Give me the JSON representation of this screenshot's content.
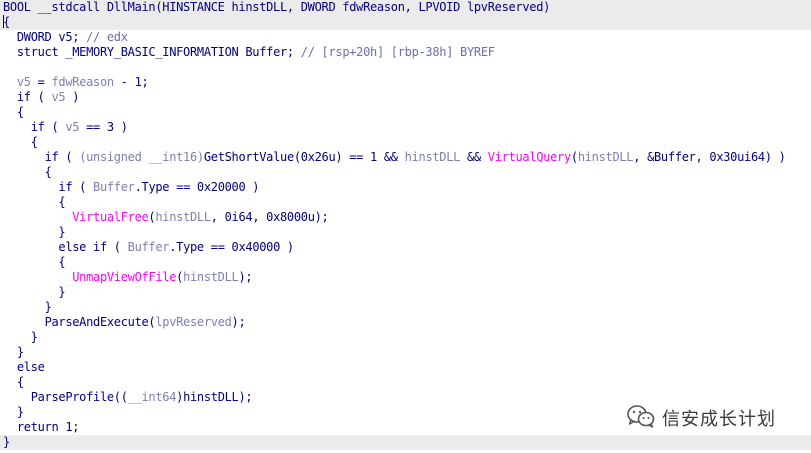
{
  "editor": {
    "highlight_color": "#ebebeb",
    "colors": {
      "plain": "#000080",
      "variable": "#7f7fb0",
      "comment": "#6d6dae",
      "function": "#ff00ff"
    },
    "lines": [
      {
        "indent": 0,
        "highlight": true,
        "cursor": false,
        "tokens": [
          {
            "t": "BOOL __stdcall DllMain(HINSTANCE hinstDLL, DWORD fdwReason, LPVOID lpvReserved)",
            "k": "p"
          }
        ]
      },
      {
        "indent": 0,
        "highlight": true,
        "cursor": true,
        "tokens": [
          {
            "t": "{",
            "k": "p"
          }
        ]
      },
      {
        "indent": 1,
        "highlight": false,
        "cursor": false,
        "tokens": [
          {
            "t": "DWORD v5; ",
            "k": "p"
          },
          {
            "t": "// edx",
            "k": "c"
          }
        ]
      },
      {
        "indent": 1,
        "highlight": false,
        "cursor": false,
        "tokens": [
          {
            "t": "struct _MEMORY_BASIC_INFORMATION Buffer; ",
            "k": "p"
          },
          {
            "t": "// [rsp+20h] [rbp-38h] BYREF",
            "k": "c"
          }
        ]
      },
      {
        "indent": 0,
        "highlight": false,
        "cursor": false,
        "tokens": []
      },
      {
        "indent": 1,
        "highlight": false,
        "cursor": false,
        "tokens": [
          {
            "t": "v5",
            "k": "v"
          },
          {
            "t": " = ",
            "k": "p"
          },
          {
            "t": "fdwReason",
            "k": "v"
          },
          {
            "t": " - 1;",
            "k": "p"
          }
        ]
      },
      {
        "indent": 1,
        "highlight": false,
        "cursor": false,
        "tokens": [
          {
            "t": "if ( ",
            "k": "p"
          },
          {
            "t": "v5",
            "k": "v"
          },
          {
            "t": " )",
            "k": "p"
          }
        ]
      },
      {
        "indent": 1,
        "highlight": false,
        "cursor": false,
        "tokens": [
          {
            "t": "{",
            "k": "p"
          }
        ]
      },
      {
        "indent": 2,
        "highlight": false,
        "cursor": false,
        "tokens": [
          {
            "t": "if ( ",
            "k": "p"
          },
          {
            "t": "v5",
            "k": "v"
          },
          {
            "t": " == 3 )",
            "k": "p"
          }
        ]
      },
      {
        "indent": 2,
        "highlight": false,
        "cursor": false,
        "tokens": [
          {
            "t": "{",
            "k": "p"
          }
        ]
      },
      {
        "indent": 3,
        "highlight": false,
        "cursor": false,
        "tokens": [
          {
            "t": "if ( ",
            "k": "p"
          },
          {
            "t": "(unsigned __int16)",
            "k": "v"
          },
          {
            "t": "GetShortValue(0x26u) == 1 && ",
            "k": "p"
          },
          {
            "t": "hinstDLL",
            "k": "v"
          },
          {
            "t": " && ",
            "k": "p"
          },
          {
            "t": "VirtualQuery",
            "k": "f"
          },
          {
            "t": "(",
            "k": "p"
          },
          {
            "t": "hinstDLL",
            "k": "v"
          },
          {
            "t": ", &Buffer, 0x30ui64) )",
            "k": "p"
          }
        ]
      },
      {
        "indent": 3,
        "highlight": false,
        "cursor": false,
        "tokens": [
          {
            "t": "{",
            "k": "p"
          }
        ]
      },
      {
        "indent": 4,
        "highlight": false,
        "cursor": false,
        "tokens": [
          {
            "t": "if ( ",
            "k": "p"
          },
          {
            "t": "Buffer",
            "k": "v"
          },
          {
            "t": ".Type == 0x20000 )",
            "k": "p"
          }
        ]
      },
      {
        "indent": 4,
        "highlight": false,
        "cursor": false,
        "tokens": [
          {
            "t": "{",
            "k": "p"
          }
        ]
      },
      {
        "indent": 5,
        "highlight": false,
        "cursor": false,
        "tokens": [
          {
            "t": "VirtualFree",
            "k": "f"
          },
          {
            "t": "(",
            "k": "p"
          },
          {
            "t": "hinstDLL",
            "k": "v"
          },
          {
            "t": ", 0i64, 0x8000u);",
            "k": "p"
          }
        ]
      },
      {
        "indent": 4,
        "highlight": false,
        "cursor": false,
        "tokens": [
          {
            "t": "}",
            "k": "p"
          }
        ]
      },
      {
        "indent": 4,
        "highlight": false,
        "cursor": false,
        "tokens": [
          {
            "t": "else if ( ",
            "k": "p"
          },
          {
            "t": "Buffer",
            "k": "v"
          },
          {
            "t": ".Type == 0x40000 )",
            "k": "p"
          }
        ]
      },
      {
        "indent": 4,
        "highlight": false,
        "cursor": false,
        "tokens": [
          {
            "t": "{",
            "k": "p"
          }
        ]
      },
      {
        "indent": 5,
        "highlight": false,
        "cursor": false,
        "tokens": [
          {
            "t": "UnmapViewOfFile",
            "k": "f"
          },
          {
            "t": "(",
            "k": "p"
          },
          {
            "t": "hinstDLL",
            "k": "v"
          },
          {
            "t": ");",
            "k": "p"
          }
        ]
      },
      {
        "indent": 4,
        "highlight": false,
        "cursor": false,
        "tokens": [
          {
            "t": "}",
            "k": "p"
          }
        ]
      },
      {
        "indent": 3,
        "highlight": false,
        "cursor": false,
        "tokens": [
          {
            "t": "}",
            "k": "p"
          }
        ]
      },
      {
        "indent": 3,
        "highlight": false,
        "cursor": false,
        "tokens": [
          {
            "t": "ParseAndExecute(",
            "k": "p"
          },
          {
            "t": "lpvReserved",
            "k": "v"
          },
          {
            "t": ");",
            "k": "p"
          }
        ]
      },
      {
        "indent": 2,
        "highlight": false,
        "cursor": false,
        "tokens": [
          {
            "t": "}",
            "k": "p"
          }
        ]
      },
      {
        "indent": 1,
        "highlight": false,
        "cursor": false,
        "tokens": [
          {
            "t": "}",
            "k": "p"
          }
        ]
      },
      {
        "indent": 1,
        "highlight": false,
        "cursor": false,
        "tokens": [
          {
            "t": "else",
            "k": "p"
          }
        ]
      },
      {
        "indent": 1,
        "highlight": false,
        "cursor": false,
        "tokens": [
          {
            "t": "{",
            "k": "p"
          }
        ]
      },
      {
        "indent": 2,
        "highlight": false,
        "cursor": false,
        "tokens": [
          {
            "t": "ParseProfile((",
            "k": "p"
          },
          {
            "t": "__int64",
            "k": "v"
          },
          {
            "t": ")hinstDLL);",
            "k": "p"
          }
        ]
      },
      {
        "indent": 1,
        "highlight": false,
        "cursor": false,
        "tokens": [
          {
            "t": "}",
            "k": "p"
          }
        ]
      },
      {
        "indent": 1,
        "highlight": false,
        "cursor": false,
        "tokens": [
          {
            "t": "return 1;",
            "k": "p"
          }
        ]
      },
      {
        "indent": 0,
        "highlight": true,
        "cursor": false,
        "tokens": [
          {
            "t": "}",
            "k": "p"
          }
        ]
      }
    ]
  },
  "watermark": {
    "text": "信安成长计划",
    "icon": "wechat-icon"
  }
}
